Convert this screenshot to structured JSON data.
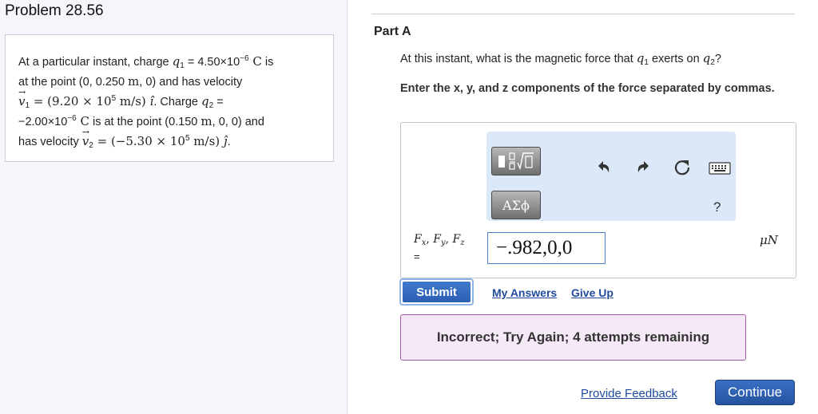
{
  "problem": {
    "title": "Problem 28.56",
    "l1_a": "At a particular instant, charge ",
    "l1_var": "q",
    "l1_sub": "1",
    "l1_eq": " = 4.50×10",
    "l1_exp": "−6",
    "l1_unit": " C",
    "l1_b": " is",
    "l2_a": "at the point (0, 0.250 ",
    "l2_unit": "m",
    "l2_b": ", 0) and has velocity",
    "l3_var": "v",
    "l3_sub": "1",
    "l3_eq": " = (9.20 × 10",
    "l3_exp": "5",
    "l3_unit": " m/s) ",
    "l3_hat": "î",
    "l3_b": ". Charge ",
    "l3_var2": "q",
    "l3_sub2": "2",
    "l3_c": " =",
    "l4_a": "−2.00×10",
    "l4_exp": "−6",
    "l4_unit": " C",
    "l4_b": " is at the point (0.150 ",
    "l4_unit2": "m",
    "l4_c": ", 0, 0) and",
    "l5_a": "has velocity ",
    "l5_var": "v",
    "l5_sub": "2",
    "l5_eq": " = (−5.30 × 10",
    "l5_exp": "5",
    "l5_unit": " m/s) ",
    "l5_hat": "ĵ",
    "l5_b": "."
  },
  "part": {
    "title": "Part A",
    "question_a": "At this instant, what is the magnetic force that ",
    "question_var1": "q",
    "question_sub1": "1",
    "question_b": " exerts on ",
    "question_var2": "q",
    "question_sub2": "2",
    "question_c": "?",
    "instruction": "Enter the x, y, and z components of the force separated by commas."
  },
  "toolbar": {
    "greek_label": "ΑΣϕ",
    "help_label": "?",
    "icons": [
      "templates-icon",
      "undo-icon",
      "redo-icon",
      "reset-icon",
      "keyboard-icon",
      "greek-icon",
      "help-icon"
    ]
  },
  "answer": {
    "label_f": "F",
    "label_x": "x",
    "label_y": "y",
    "label_z": "z",
    "label_eq": "=",
    "value": "−.982,0,0",
    "unit": "μN"
  },
  "actions": {
    "submit": "Submit",
    "my_answers": "My Answers",
    "give_up": "Give Up",
    "provide_feedback": "Provide Feedback",
    "continue": "Continue"
  },
  "feedback": {
    "message": "Incorrect; Try Again; 4 attempts remaining"
  },
  "colors": {
    "toolbar_bg": "#dbe8f8",
    "submit_blue": "#2b5fb3",
    "feedback_bg": "#f5e8f7",
    "feedback_border": "#a35ba8",
    "link_blue": "#1f4a9e"
  }
}
